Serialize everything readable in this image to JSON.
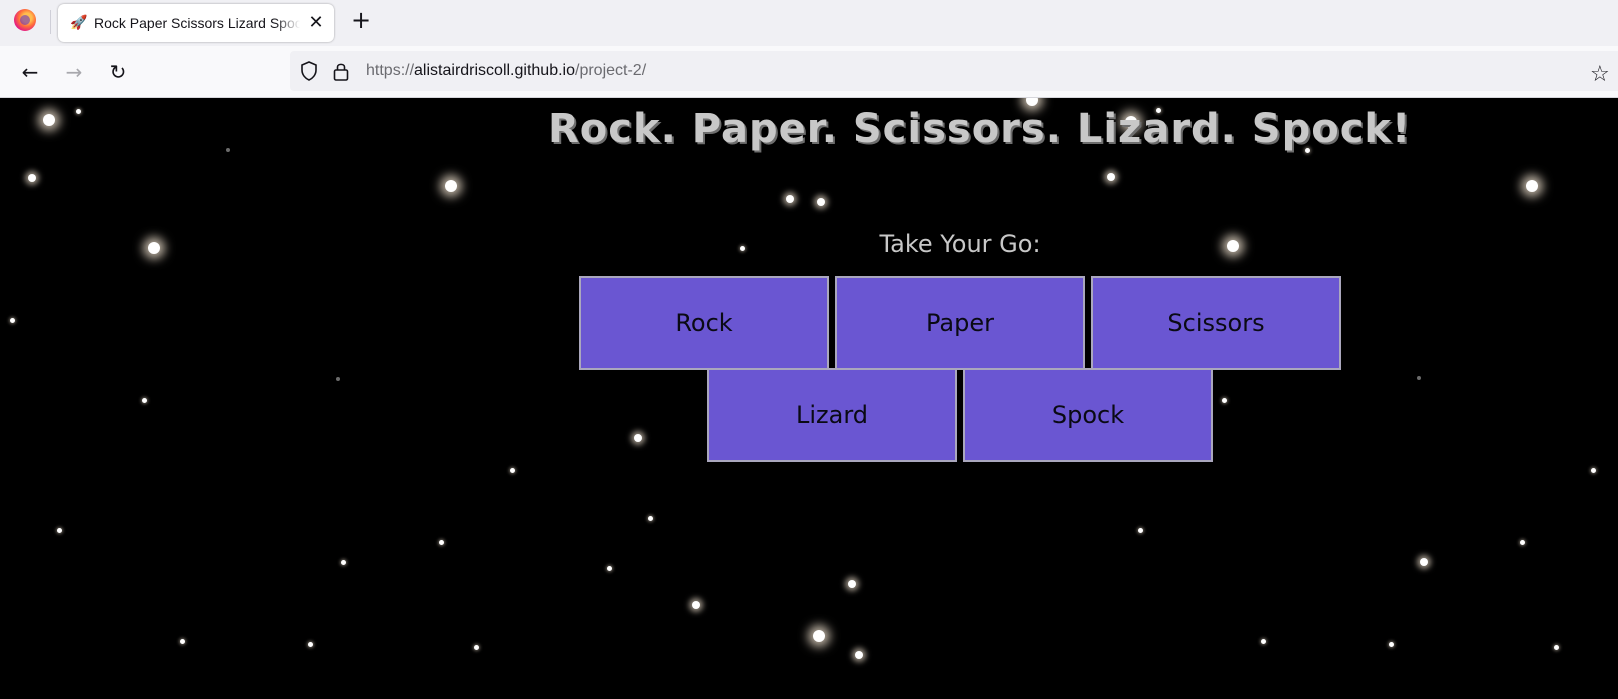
{
  "browser": {
    "tab_title": "Rock Paper Scissors Lizard Spock",
    "url_scheme": "https://",
    "url_host": "alistairdriscoll.github.io",
    "url_path": "/project-2/",
    "icons": {
      "browser_logo": "firefox-logo-icon",
      "tab_favicon": "rocket-icon",
      "tab_close": "close-icon",
      "new_tab": "plus-icon",
      "back": "back-arrow-icon",
      "forward": "forward-arrow-icon",
      "reload": "reload-icon",
      "tracking": "shield-icon",
      "secure": "lock-icon",
      "bookmark": "star-icon"
    }
  },
  "game": {
    "title": "Rock. Paper. Scissors. Lizard. Spock!",
    "prompt": "Take Your Go:",
    "choices": [
      "Rock",
      "Paper",
      "Scissors",
      "Lizard",
      "Spock"
    ],
    "button_color": "#6a56d2",
    "background_color": "#000000"
  }
}
